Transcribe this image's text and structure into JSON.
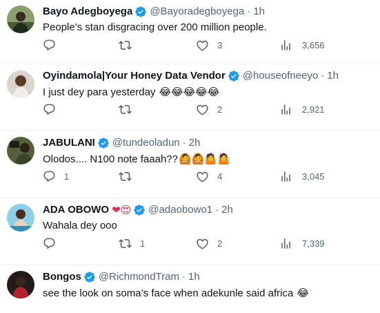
{
  "tweets": [
    {
      "name": "Bayo Adegboyega",
      "handle": "@Bayoradegboyega",
      "dot": "·",
      "time": "1h",
      "text": "People's stan disgracing over 200 million people.",
      "emoji": "",
      "replies": "",
      "retweets": "",
      "likes": "3",
      "views": "3,656",
      "avatar_color": "#2f3b2a"
    },
    {
      "name": "Oyindamola|Your Honey Data Vendor",
      "handle": "@houseofneeyo",
      "dot": "·",
      "time": "1h",
      "text": "I just dey para yesterday",
      "emoji": "😂😂😂😂😂",
      "replies": "",
      "retweets": "",
      "likes": "2",
      "views": "2,921",
      "avatar_color": "#c9c2b8"
    },
    {
      "name": "JABULANI",
      "handle": "@tundeoladun",
      "dot": "·",
      "time": "2h",
      "text": "Olodos.... N100 note faaah??",
      "emoji": "🙆🙆🤷🤷",
      "replies": "1",
      "retweets": "",
      "likes": "4",
      "views": "3,045",
      "avatar_color": "#3d4733"
    },
    {
      "name": "ADA OBOWO",
      "name_emoji": "❤😍",
      "handle": "@adaobowo1",
      "dot": "·",
      "time": "2h",
      "text": "Wahala dey ooo",
      "emoji": "",
      "replies": "",
      "retweets": "1",
      "likes": "2",
      "views": "7,339",
      "avatar_color": "#4aa3c8"
    },
    {
      "name": "Bongos",
      "handle": "@RichmondTram",
      "dot": "·",
      "time": "1h",
      "text": "see the look on soma’s face when adekunle said africa",
      "emoji": "😂",
      "avatar_color": "#6a1f24"
    }
  ],
  "colors": {
    "verified": "#1d9bf0",
    "muted": "#536471",
    "border": "#eff3f4"
  },
  "icons": [
    "reply-icon",
    "retweet-icon",
    "like-icon",
    "views-icon",
    "verified-badge-icon"
  ]
}
